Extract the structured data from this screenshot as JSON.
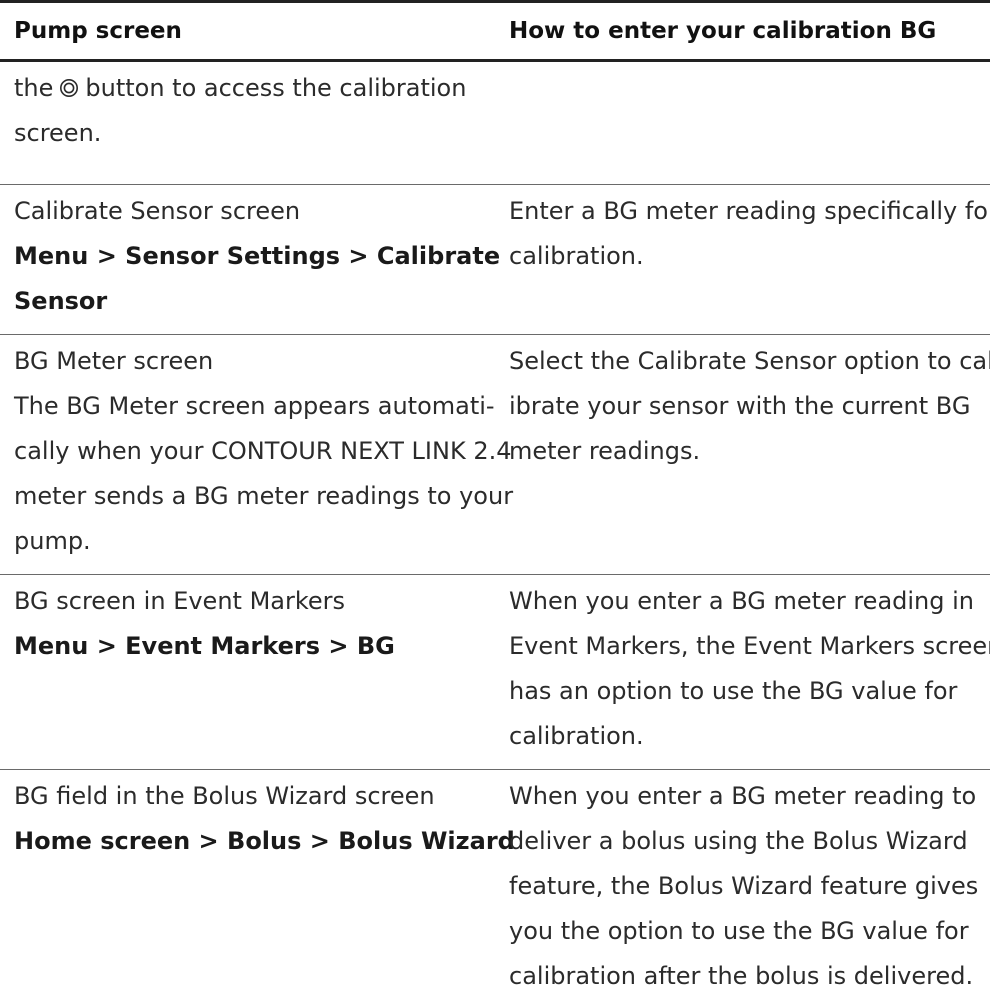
{
  "header": {
    "col1": "Pump screen",
    "col2": "How to enter your calibration BG"
  },
  "rows": [
    {
      "col1": {
        "prefix": "the",
        "icon": "select-button-icon",
        "suffix": "button to access the calibration",
        "line2": "screen."
      }
    },
    {
      "col1": {
        "title": "Calibrate Sensor screen",
        "path_line1": "Menu > Sensor Settings > Calibrate",
        "path_line2": "Sensor"
      },
      "col2": {
        "line1": "Enter a BG meter reading specifically for",
        "line2": "calibration."
      }
    },
    {
      "col1": {
        "title": "BG Meter screen",
        "line1": "The BG Meter screen appears automati-",
        "line2": "cally when your CONTOUR NEXT LINK 2.4",
        "line3": "meter sends a BG meter readings to your",
        "line4": "pump."
      },
      "col2": {
        "line1": "Select the Calibrate Sensor option to cal-",
        "line2": "ibrate your sensor with the current BG",
        "line3": "meter readings."
      }
    },
    {
      "col1": {
        "title": "BG screen in Event Markers",
        "path": "Menu > Event Markers > BG"
      },
      "col2": {
        "line1": "When you enter a BG meter reading in",
        "line2": "Event Markers, the Event Markers screen",
        "line3": "has an option to use the BG value for",
        "line4": "calibration."
      }
    },
    {
      "col1": {
        "title": "BG field in the Bolus Wizard screen",
        "path": "Home screen > Bolus > Bolus Wizard"
      },
      "col2": {
        "line1": "When you enter a BG meter reading to",
        "line2": "deliver a bolus using the Bolus Wizard",
        "line3": "feature, the Bolus Wizard feature gives",
        "line4": "you the option to use the BG value for",
        "line5": "calibration after the bolus is delivered."
      }
    }
  ]
}
